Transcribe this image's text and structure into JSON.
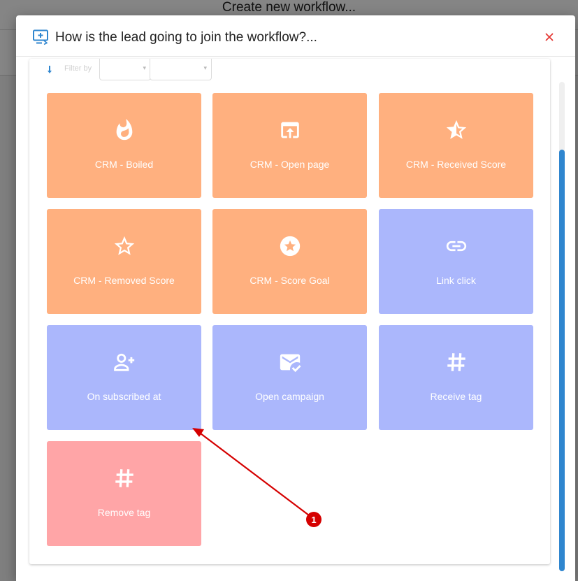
{
  "background": {
    "page_title": "Create new workflow..."
  },
  "dialog": {
    "title": "How is the lead going to join the workflow?...",
    "close_label": "×",
    "icon": "monitor-plus-icon"
  },
  "filter": {
    "label": "Filter by",
    "icon": "filter-icon"
  },
  "colors": {
    "orange": "#ffb07f",
    "blue": "#abb7fc",
    "red": "#ffa5a7",
    "accent": "#2f86cf",
    "close": "#e53935",
    "annotation": "#d50000"
  },
  "tiles": [
    {
      "label": "CRM - Boiled",
      "icon": "fire-icon",
      "color": "orange"
    },
    {
      "label": "CRM - Open page",
      "icon": "open-in-browser-icon",
      "color": "orange"
    },
    {
      "label": "CRM - Received Score",
      "icon": "star-half-icon",
      "color": "orange"
    },
    {
      "label": "CRM - Removed Score",
      "icon": "star-outline-icon",
      "color": "orange"
    },
    {
      "label": "CRM - Score Goal",
      "icon": "star-circle-icon",
      "color": "orange"
    },
    {
      "label": "Link click",
      "icon": "link-icon",
      "color": "blue"
    },
    {
      "label": "On subscribed at",
      "icon": "person-add-icon",
      "color": "blue"
    },
    {
      "label": "Open campaign",
      "icon": "mark-email-read-icon",
      "color": "blue"
    },
    {
      "label": "Receive tag",
      "icon": "hashtag-icon",
      "color": "blue"
    },
    {
      "label": "Remove tag",
      "icon": "hashtag-icon",
      "color": "red"
    }
  ],
  "annotation": {
    "marker": "1"
  }
}
